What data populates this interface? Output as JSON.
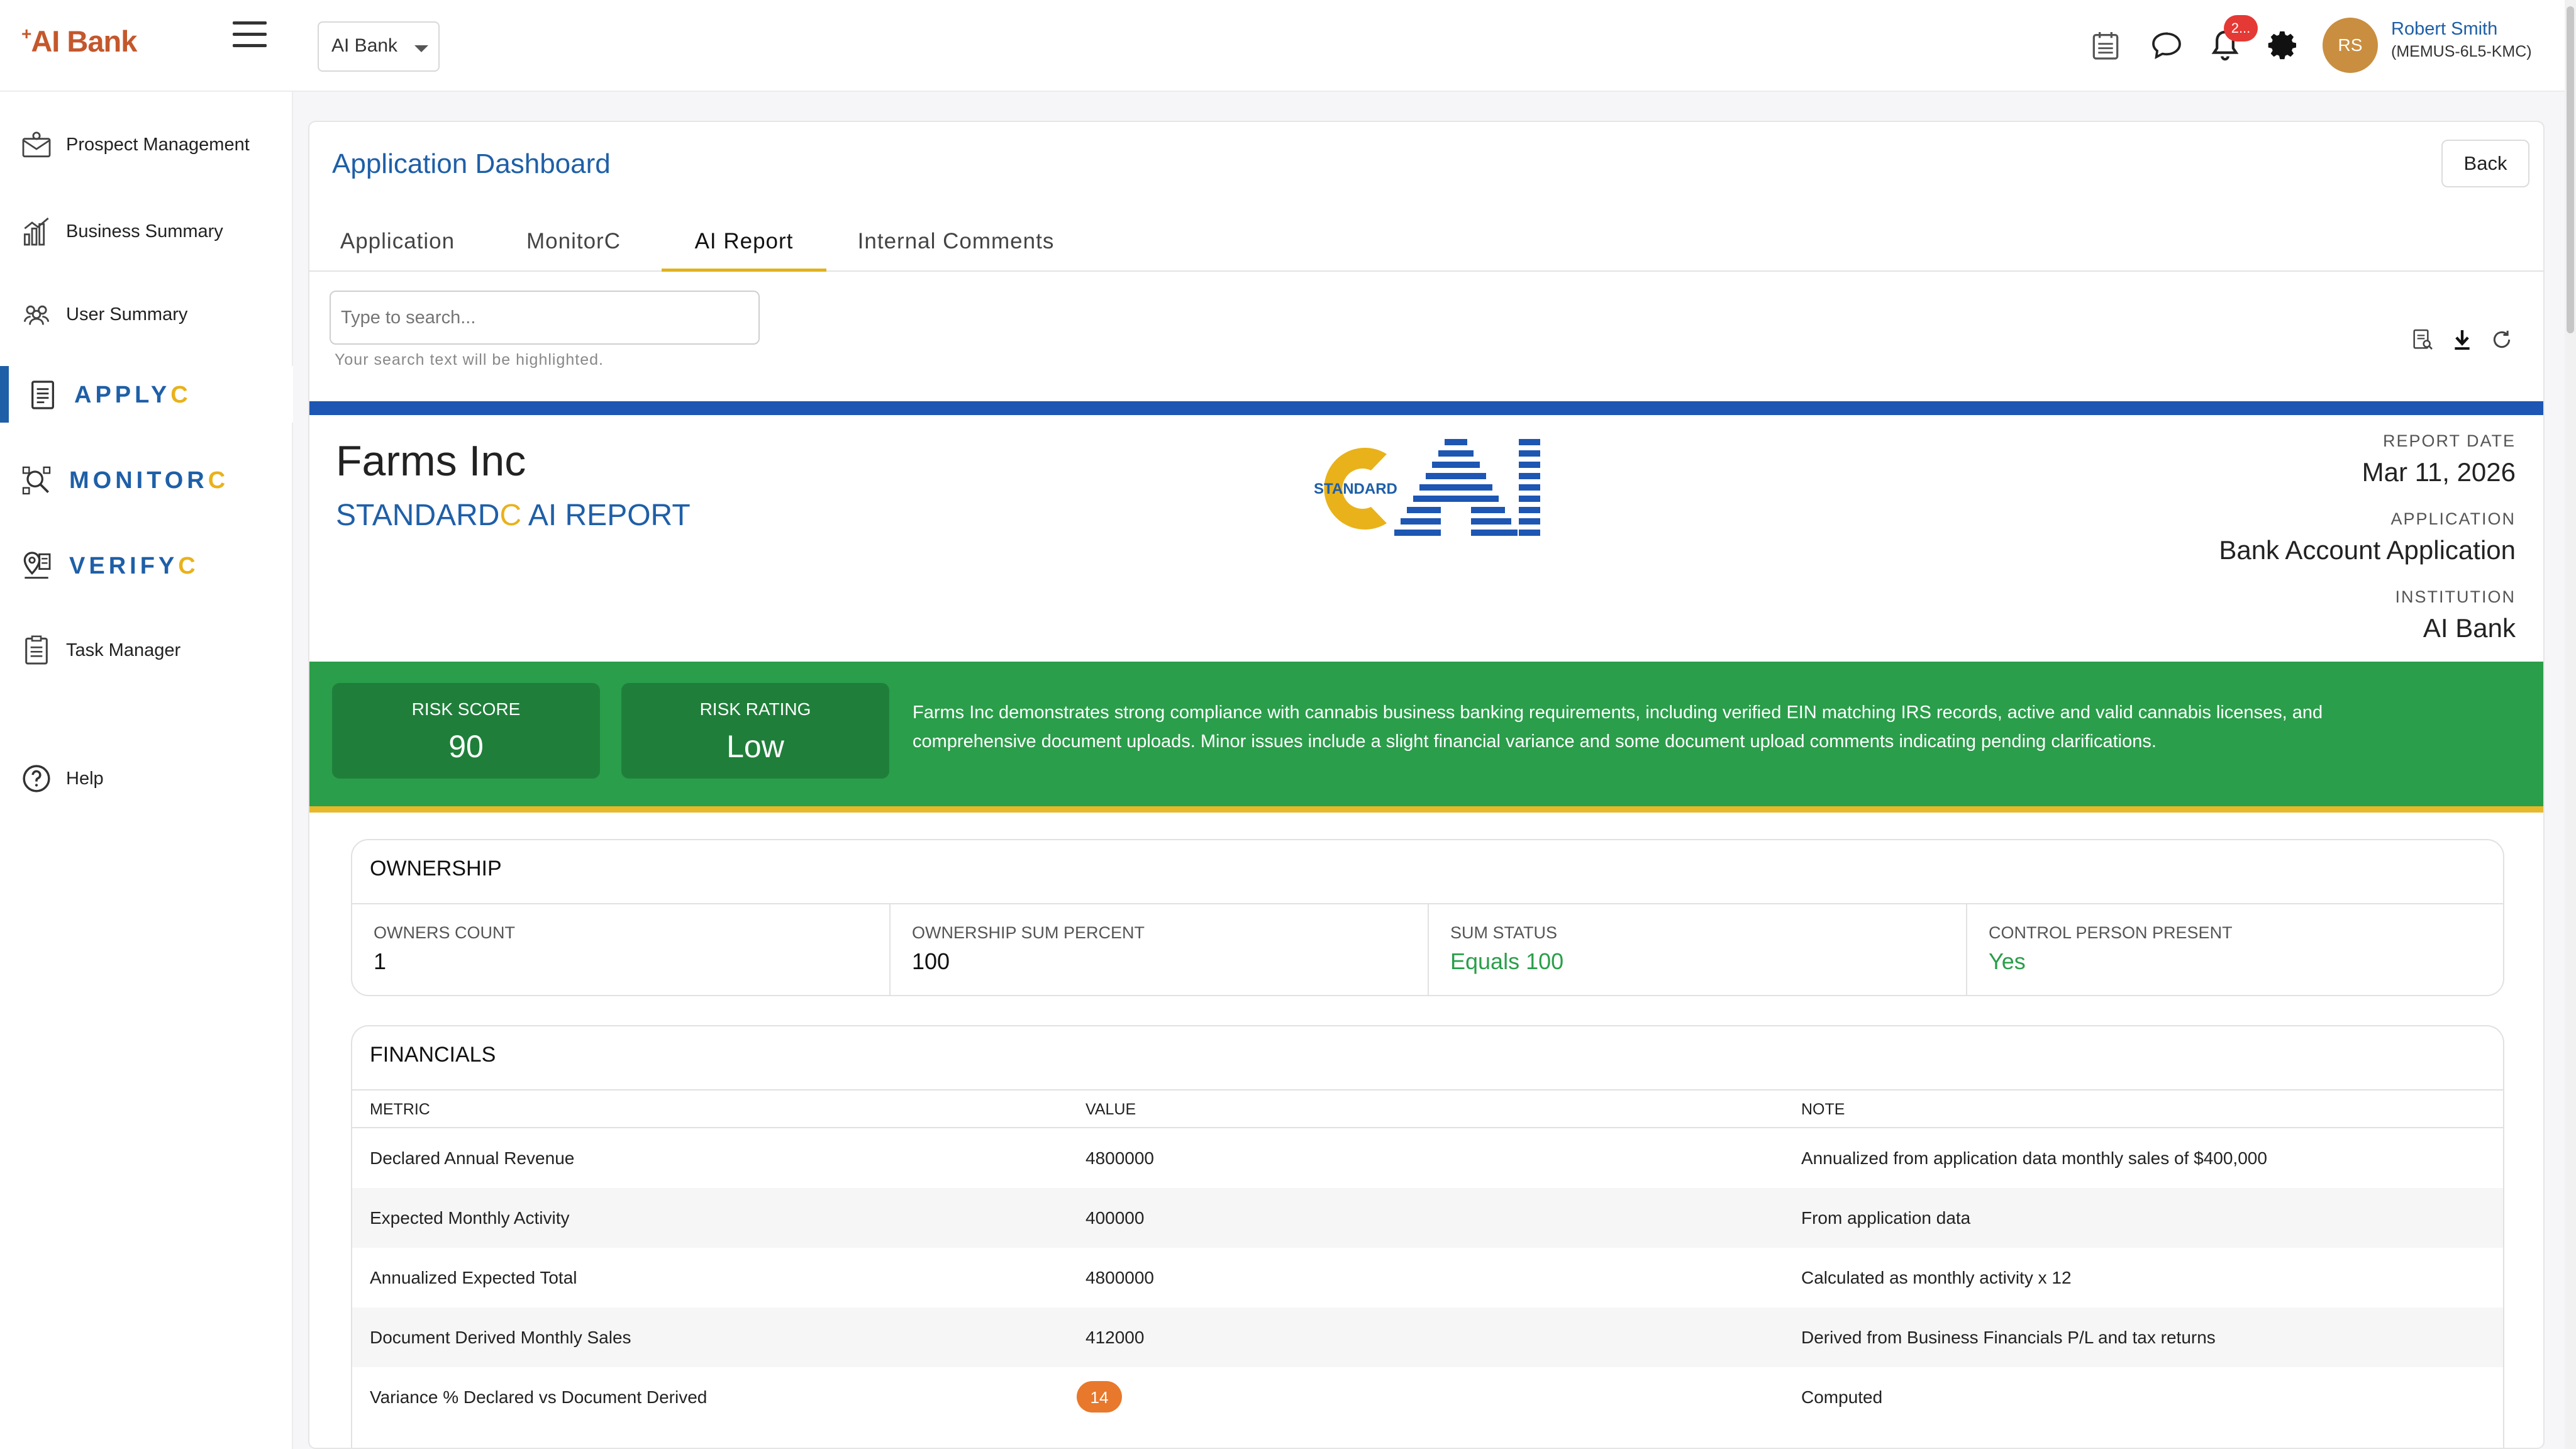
{
  "app": {
    "brand": "AI Bank",
    "bank_select": "AI Bank",
    "notification_count": "2...",
    "user_initials": "RS",
    "user_name": "Robert Smith",
    "user_id": "(MEMUS-6L5-KMC)"
  },
  "sidebar": {
    "items": [
      {
        "label": "Prospect Management",
        "icon": "prospect-icon"
      },
      {
        "label": "Business Summary",
        "icon": "chart-icon"
      },
      {
        "label": "User Summary",
        "icon": "users-icon"
      },
      {
        "label": "APPLY",
        "suffix": "C",
        "icon": "document-icon"
      },
      {
        "label": "MONITOR",
        "suffix": "C",
        "icon": "monitor-icon"
      },
      {
        "label": "VERIFY",
        "suffix": "C",
        "icon": "verify-icon"
      },
      {
        "label": "Task Manager",
        "icon": "tasks-icon"
      },
      {
        "label": "Help",
        "icon": "help-icon"
      }
    ]
  },
  "dashboard": {
    "title": "Application Dashboard",
    "back_label": "Back",
    "tabs": [
      "Application",
      "MonitorC",
      "AI Report",
      "Internal Comments"
    ],
    "active_tab": "AI Report",
    "search_placeholder": "Type to search...",
    "search_hint": "Your search text will be highlighted."
  },
  "report": {
    "company": "Farms Inc",
    "subtitle_a": "STANDARD",
    "subtitle_c": "C",
    "subtitle_b": " AI REPORT",
    "logo_text": "STANDARD",
    "report_date_label": "REPORT DATE",
    "report_date": "Mar 11, 2026",
    "application_label": "APPLICATION",
    "application": "Bank Account Application",
    "institution_label": "INSTITUTION",
    "institution": "AI Bank",
    "risk_score_label": "RISK SCORE",
    "risk_score": "90",
    "risk_rating_label": "RISK RATING",
    "risk_rating": "Low",
    "summary": "Farms Inc demonstrates strong compliance with cannabis business banking requirements, including verified EIN matching IRS records, active and valid cannabis licenses, and comprehensive document uploads. Minor issues include a slight financial variance and some document upload comments indicating pending clarifications."
  },
  "ownership": {
    "title": "OWNERSHIP",
    "cells": [
      {
        "label": "OWNERS COUNT",
        "value": "1"
      },
      {
        "label": "OWNERSHIP SUM PERCENT",
        "value": "100"
      },
      {
        "label": "SUM STATUS",
        "value": "Equals 100"
      },
      {
        "label": "CONTROL PERSON PRESENT",
        "value": "Yes"
      }
    ]
  },
  "financials": {
    "title": "FINANCIALS",
    "headers": [
      "METRIC",
      "VALUE",
      "NOTE"
    ],
    "rows": [
      {
        "metric": "Declared Annual Revenue",
        "value": "4800000",
        "note": "Annualized from application data monthly sales of $400,000"
      },
      {
        "metric": "Expected Monthly Activity",
        "value": "400000",
        "note": "From application data"
      },
      {
        "metric": "Annualized Expected Total",
        "value": "4800000",
        "note": "Calculated as monthly activity x 12"
      },
      {
        "metric": "Document Derived Monthly Sales",
        "value": "412000",
        "note": "Derived from Business Financials P/L and tax returns"
      },
      {
        "metric": "Variance % Declared vs Document Derived",
        "value": "14",
        "note": "Computed"
      }
    ]
  },
  "colors": {
    "primary": "#1e5fa8",
    "accent": "#e9b21a",
    "success": "#2a9e4a",
    "warning": "#e8782b"
  }
}
